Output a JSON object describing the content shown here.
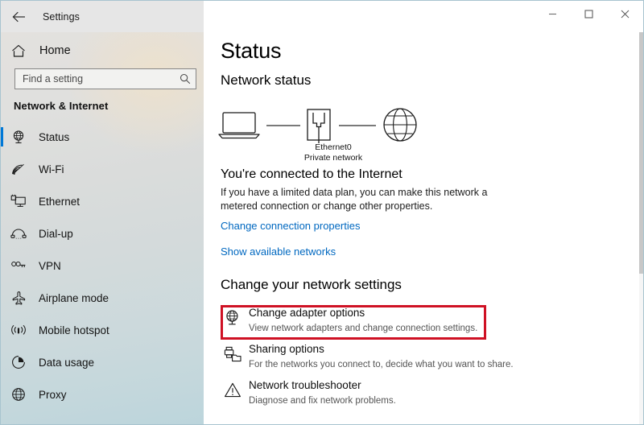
{
  "window": {
    "title": "Settings",
    "back_icon": "back-arrow-icon",
    "minimize_label": "Minimize",
    "maximize_label": "Maximize",
    "close_label": "Close"
  },
  "sidebar": {
    "home_label": "Home",
    "home_icon": "home-icon",
    "search": {
      "placeholder": "Find a setting",
      "value": "",
      "icon": "search-icon"
    },
    "section_title": "Network & Internet",
    "selected_accent": "#0078d7",
    "items": [
      {
        "label": "Status",
        "icon": "globe-monitor-icon",
        "selected": true
      },
      {
        "label": "Wi-Fi",
        "icon": "wifi-icon",
        "selected": false
      },
      {
        "label": "Ethernet",
        "icon": "ethernet-monitor-icon",
        "selected": false
      },
      {
        "label": "Dial-up",
        "icon": "dialup-phone-icon",
        "selected": false
      },
      {
        "label": "VPN",
        "icon": "vpn-key-icon",
        "selected": false
      },
      {
        "label": "Airplane mode",
        "icon": "airplane-icon",
        "selected": false
      },
      {
        "label": "Mobile hotspot",
        "icon": "hotspot-icon",
        "selected": false
      },
      {
        "label": "Data usage",
        "icon": "data-usage-pie-icon",
        "selected": false
      },
      {
        "label": "Proxy",
        "icon": "proxy-globe-icon",
        "selected": false
      }
    ]
  },
  "main": {
    "page_title": "Status",
    "network_status_heading": "Network status",
    "diagram": {
      "device_icon": "laptop-icon",
      "adapter_icon": "ethernet-adapter-icon",
      "internet_icon": "globe-icon",
      "adapter_name": "Ethernet0",
      "adapter_type": "Private network"
    },
    "connection": {
      "heading": "You're connected to the Internet",
      "description": "If you have a limited data plan, you can make this network a metered connection or change other properties."
    },
    "links": [
      {
        "label": "Change connection properties"
      },
      {
        "label": "Show available networks"
      }
    ],
    "link_color": "#0068c0",
    "change_settings_heading": "Change your network settings",
    "settings": [
      {
        "title": "Change adapter options",
        "subtitle": "View network adapters and change connection settings.",
        "icon": "adapter-globe-icon",
        "highlighted": true
      },
      {
        "title": "Sharing options",
        "subtitle": "For the networks you connect to, decide what you want to share.",
        "icon": "sharing-printer-folder-icon",
        "highlighted": false
      },
      {
        "title": "Network troubleshooter",
        "subtitle": "Diagnose and fix network problems.",
        "icon": "warning-triangle-icon",
        "highlighted": false
      }
    ],
    "highlight_color": "#cf1124"
  }
}
